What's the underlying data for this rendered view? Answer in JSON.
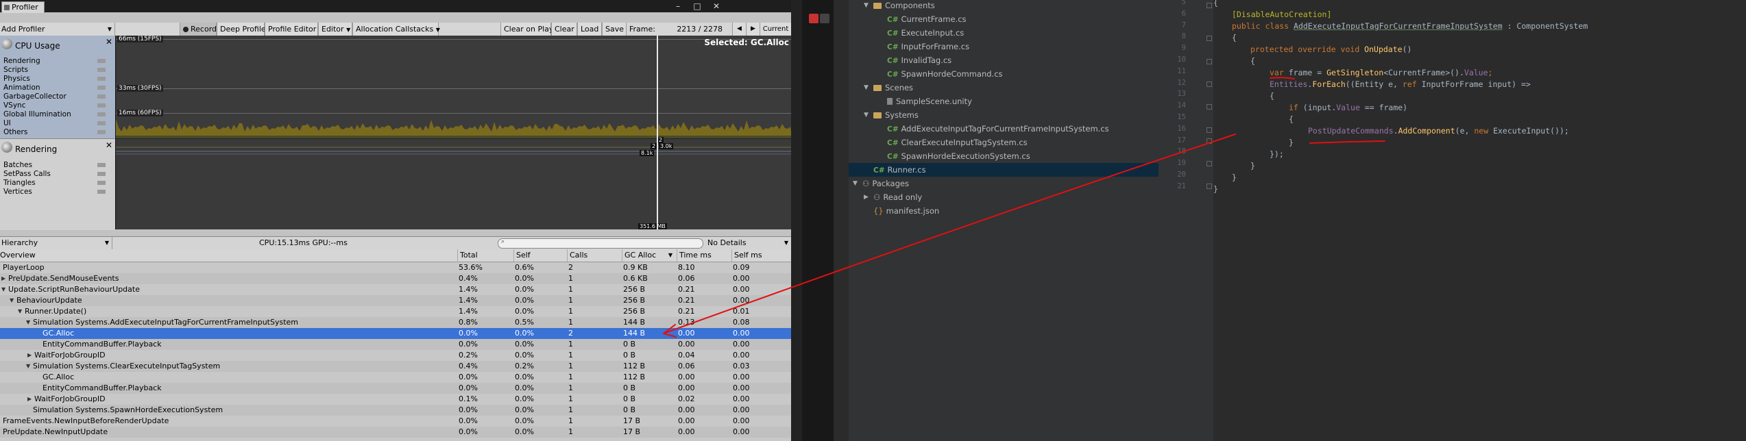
{
  "profiler": {
    "tab_label": "Profiler",
    "add_profiler": "Add Profiler",
    "toolbar": {
      "record": "Record",
      "deep_profile": "Deep Profile",
      "profile_editor": "Profile Editor",
      "editor": "Editor",
      "allocation_callstacks": "Allocation Callstacks",
      "clear_on_play": "Clear on Play",
      "clear": "Clear",
      "load": "Load",
      "save": "Save",
      "frame_label": "Frame:",
      "frame_value": "2213 / 2278",
      "nav_prev": "◀",
      "nav_next": "▶",
      "nav_current": "Current"
    },
    "modules": {
      "cpu": {
        "title": "CPU Usage",
        "items": [
          "Rendering",
          "Scripts",
          "Physics",
          "Animation",
          "GarbageCollector",
          "VSync",
          "Global Illumination",
          "UI",
          "Others"
        ]
      },
      "rendering": {
        "title": "Rendering",
        "items": [
          "Batches",
          "SetPass Calls",
          "Triangles",
          "Vertices"
        ]
      }
    },
    "chart": {
      "ms_66": "66ms (15FPS)",
      "ms_33": "33ms (30FPS)",
      "ms_16": "16ms (60FPS)",
      "selected": "Selected: GC.Alloc",
      "tag_a": "2",
      "tag_b": "2",
      "tag_c": "3.0k",
      "tag_d": "8.1k",
      "tag_bottom": "351.6 MB"
    },
    "hierarchy_bar": {
      "view": "Hierarchy",
      "cpu_gpu": "CPU:15.13ms   GPU:--ms",
      "details": "No Details"
    },
    "table": {
      "columns": [
        "Overview",
        "Total",
        "Self",
        "Calls",
        "GC Alloc",
        "Time ms",
        "Self ms"
      ],
      "rows": [
        {
          "name": "PlayerLoop",
          "total": "53.6%",
          "self": "0.6%",
          "calls": "2",
          "gc": "0.9 KB",
          "time": "8.10",
          "selfms": "0.09"
        },
        {
          "name": "PreUpdate.SendMouseEvents",
          "total": "0.4%",
          "self": "0.0%",
          "calls": "1",
          "gc": "0.6 KB",
          "time": "0.06",
          "selfms": "0.00"
        },
        {
          "name": "Update.ScriptRunBehaviourUpdate",
          "total": "1.4%",
          "self": "0.0%",
          "calls": "1",
          "gc": "256 B",
          "time": "0.21",
          "selfms": "0.00"
        },
        {
          "name": "BehaviourUpdate",
          "total": "1.4%",
          "self": "0.0%",
          "calls": "1",
          "gc": "256 B",
          "time": "0.21",
          "selfms": "0.00"
        },
        {
          "name": "Runner.Update()",
          "total": "1.4%",
          "self": "0.0%",
          "calls": "1",
          "gc": "256 B",
          "time": "0.21",
          "selfms": "0.01"
        },
        {
          "name": "Simulation Systems.AddExecuteInputTagForCurrentFrameInputSystem",
          "total": "0.8%",
          "self": "0.5%",
          "calls": "1",
          "gc": "144 B",
          "time": "0.13",
          "selfms": "0.08"
        },
        {
          "name": "GC.Alloc",
          "total": "0.0%",
          "self": "0.0%",
          "calls": "2",
          "gc": "144 B",
          "time": "0.00",
          "selfms": "0.00"
        },
        {
          "name": "EntityCommandBuffer.Playback",
          "total": "0.0%",
          "self": "0.0%",
          "calls": "1",
          "gc": "0 B",
          "time": "0.00",
          "selfms": "0.00"
        },
        {
          "name": "WaitForJobGroupID",
          "total": "0.2%",
          "self": "0.0%",
          "calls": "1",
          "gc": "0 B",
          "time": "0.04",
          "selfms": "0.00"
        },
        {
          "name": "Simulation Systems.ClearExecuteInputTagSystem",
          "total": "0.4%",
          "self": "0.2%",
          "calls": "1",
          "gc": "112 B",
          "time": "0.06",
          "selfms": "0.03"
        },
        {
          "name": "GC.Alloc",
          "total": "0.0%",
          "self": "0.0%",
          "calls": "1",
          "gc": "112 B",
          "time": "0.00",
          "selfms": "0.00"
        },
        {
          "name": "EntityCommandBuffer.Playback",
          "total": "0.0%",
          "self": "0.0%",
          "calls": "1",
          "gc": "0 B",
          "time": "0.00",
          "selfms": "0.00"
        },
        {
          "name": "WaitForJobGroupID",
          "total": "0.1%",
          "self": "0.0%",
          "calls": "1",
          "gc": "0 B",
          "time": "0.02",
          "selfms": "0.00"
        },
        {
          "name": "Simulation Systems.SpawnHordeExecutionSystem",
          "total": "0.0%",
          "self": "0.0%",
          "calls": "1",
          "gc": "0 B",
          "time": "0.00",
          "selfms": "0.00"
        },
        {
          "name": "FrameEvents.NewInputBeforeRenderUpdate",
          "total": "0.0%",
          "self": "0.0%",
          "calls": "1",
          "gc": "17 B",
          "time": "0.00",
          "selfms": "0.00"
        },
        {
          "name": "PreUpdate.NewInputUpdate",
          "total": "0.0%",
          "self": "0.0%",
          "calls": "1",
          "gc": "17 B",
          "time": "0.00",
          "selfms": "0.00"
        }
      ]
    }
  },
  "project": {
    "items": [
      {
        "label": "Components"
      },
      {
        "label": "CurrentFrame.cs"
      },
      {
        "label": "ExecuteInput.cs"
      },
      {
        "label": "InputForFrame.cs"
      },
      {
        "label": "InvalidTag.cs"
      },
      {
        "label": "SpawnHordeCommand.cs"
      },
      {
        "label": "Scenes"
      },
      {
        "label": "SampleScene.unity"
      },
      {
        "label": "Systems"
      },
      {
        "label": "AddExecuteInputTagForCurrentFrameInputSystem.cs"
      },
      {
        "label": "ClearExecuteInputTagSystem.cs"
      },
      {
        "label": "SpawnHordeExecutionSystem.cs"
      },
      {
        "label": "Runner.cs"
      },
      {
        "label": "Packages"
      },
      {
        "label": "Read only"
      },
      {
        "label": "manifest.json"
      }
    ],
    "cs_glyph": "C#"
  },
  "editor": {
    "line_numbers": [
      "5",
      "6",
      "7",
      "8",
      "9",
      "10",
      "11",
      "12",
      "13",
      "14",
      "15",
      "16",
      "17",
      "18",
      "19",
      "20",
      "21"
    ],
    "code": {
      "l5": "{",
      "l6_attr": "[DisableAutoCreation]",
      "l7_public": "public class ",
      "l7_name": "AddExecuteInputTagForCurrentFrameInputSystem",
      "l7_base": " : ComponentSystem",
      "l8": "{",
      "l9_kw": "protected override void ",
      "l9_fn": "OnUpdate",
      "l9_rest": "()",
      "l10": "{",
      "l11_var": "var ",
      "l11_frame": "frame",
      "l11_eq": " = ",
      "l11_fn": "GetSingleton",
      "l11_rest": "<CurrentFrame>().",
      "l11_prop": "Value",
      "l11_end": ";",
      "l12_ent": "Entities",
      "l12_dot": ".",
      "l12_fn": "ForEach",
      "l12_rest": "((Entity e, ",
      "l12_ref": "ref ",
      "l12_tail": "InputForFrame input) =>",
      "l13": "{",
      "l14_if": "if ",
      "l14_open": "(input.",
      "l14_prop": "Value",
      "l14_rest": " == frame)",
      "l15": "{",
      "l16_post": "PostUpdateCommands",
      "l16_dot": ".",
      "l16_fn": "AddComponent",
      "l16_args": "(e, ",
      "l16_new": "new ",
      "l16_tail": "ExecuteInput());",
      "l17": "}",
      "l18": "});",
      "l19": "}",
      "l20": "}",
      "l21": "}"
    }
  },
  "colors": {
    "selected_row": "#3a72d6",
    "annotation": "#e01010",
    "chart_fill": "#7a6a1e"
  }
}
